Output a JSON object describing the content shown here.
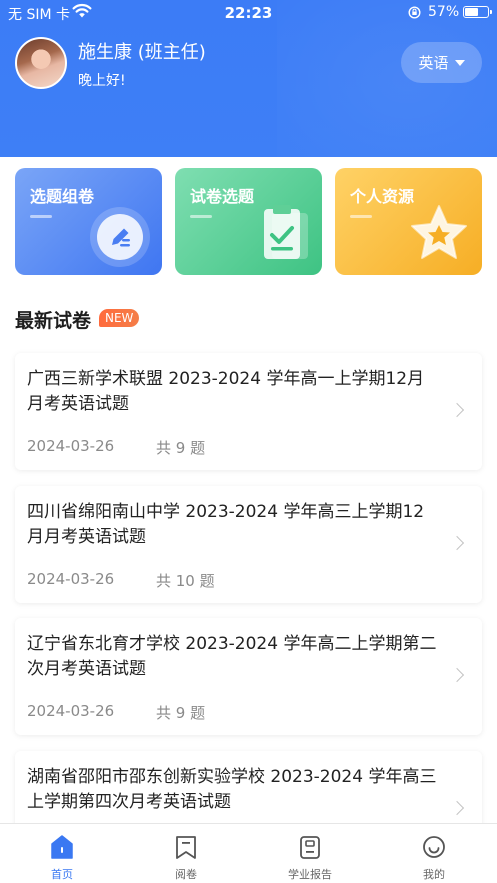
{
  "status": {
    "carrier": "无 SIM 卡",
    "time": "22:23",
    "battery": "57%"
  },
  "user": {
    "name": "施生康 (班主任)",
    "greeting": "晚上好!"
  },
  "subject": {
    "label": "英语"
  },
  "cards": [
    {
      "title": "选题组卷"
    },
    {
      "title": "试卷选题"
    },
    {
      "title": "个人资源"
    }
  ],
  "section": {
    "title": "最新试卷",
    "badge": "NEW"
  },
  "papers": [
    {
      "title": "广西三新学术联盟 2023-2024 学年高一上学期12月月考英语试题",
      "date": "2024-03-26",
      "count": "共 9 题"
    },
    {
      "title": "四川省绵阳南山中学 2023-2024 学年高三上学期12月月考英语试题",
      "date": "2024-03-26",
      "count": "共 10 题"
    },
    {
      "title": "辽宁省东北育才学校 2023-2024 学年高二上学期第二次月考英语试题",
      "date": "2024-03-26",
      "count": "共 9 题"
    },
    {
      "title": "湖南省邵阳市邵东创新实验学校 2023-2024 学年高三上学期第四次月考英语试题",
      "date": "",
      "count": ""
    }
  ],
  "tabs": [
    {
      "label": "首页",
      "icon": "home-icon",
      "active": true
    },
    {
      "label": "阅卷",
      "icon": "bookmark-icon",
      "active": false
    },
    {
      "label": "学业报告",
      "icon": "report-icon",
      "active": false
    },
    {
      "label": "我的",
      "icon": "smiley-icon",
      "active": false
    }
  ],
  "colors": {
    "primary": "#3c7cf6",
    "green": "#3ec383",
    "orange": "#f6ae25",
    "badge": "#ff6b3d"
  }
}
